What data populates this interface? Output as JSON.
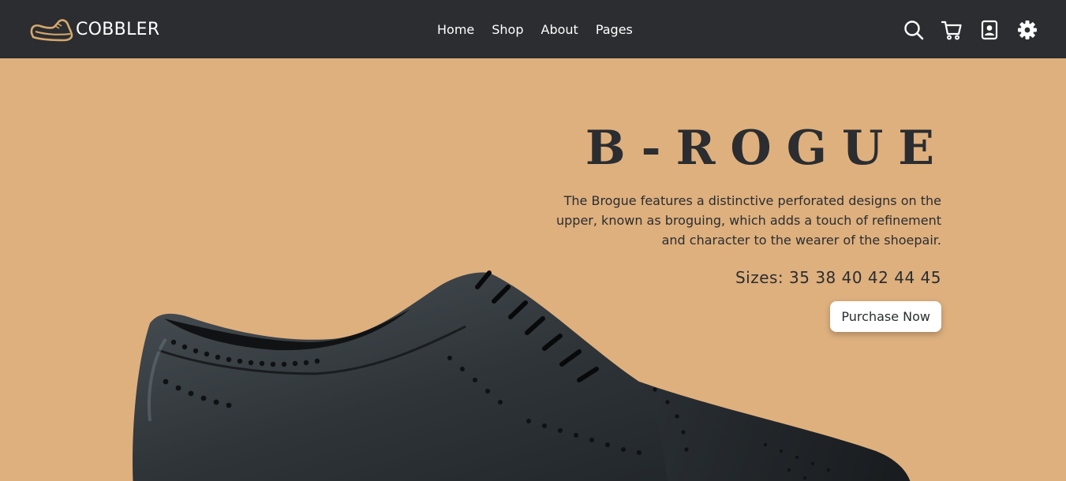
{
  "brand": {
    "name": "COBBLER",
    "logo_icon": "shoe-logo-icon",
    "logo_color": "#D7A86E"
  },
  "nav": {
    "links": [
      "Home",
      "Shop",
      "About",
      "Pages"
    ],
    "icons": [
      "search-icon",
      "cart-icon",
      "contact-icon",
      "gear-icon"
    ]
  },
  "hero": {
    "title": "B-ROGUE",
    "description": "The Brogue features a distinctive perforated designs on the upper, known as broguing, which adds a touch of refinement and character to the wearer of the shoepair.",
    "sizes_text": "Sizes: 35 38 40 42 44 45",
    "cta_label": "Purchase Now",
    "image": "black-brogue-shoe"
  },
  "colors": {
    "navbar": "#2B2D30",
    "hero_bg": "#DEB07E",
    "text_dark": "#2B2D30",
    "button_bg": "#FFFFFF"
  }
}
